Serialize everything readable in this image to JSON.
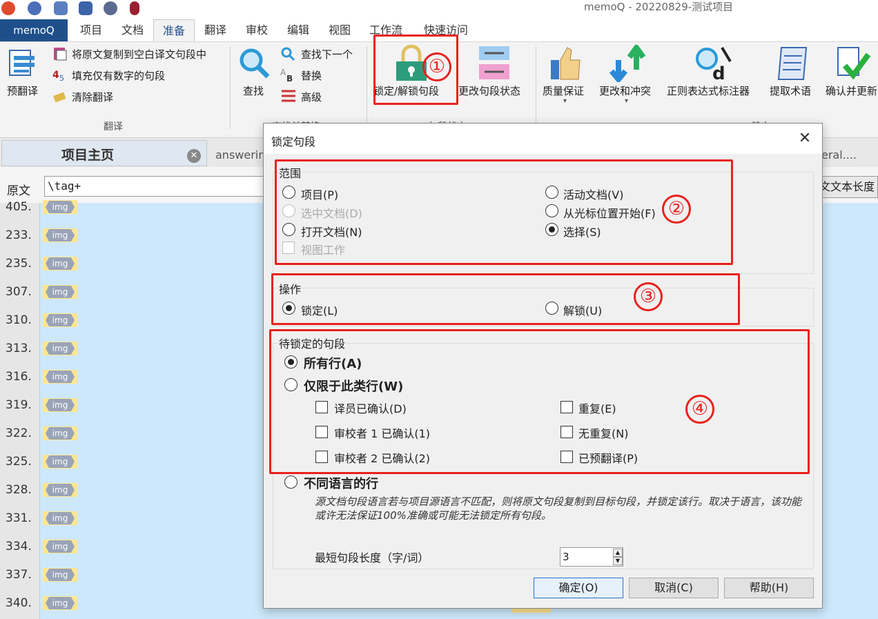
{
  "window": {
    "title": "memoQ - 20220829-测试项目"
  },
  "quick_access_icons": [
    "memoq-logo-icon",
    "help-icon",
    "settings-icon",
    "list-icon",
    "gear-icon",
    "record-icon"
  ],
  "tabs": {
    "file_label": "memoQ",
    "items": [
      "项目",
      "文档",
      "准备",
      "翻译",
      "审校",
      "编辑",
      "视图",
      "工作流",
      "快速访问"
    ],
    "active": "准备"
  },
  "ribbon": {
    "pretranslate": "预翻译",
    "copy_source": "将原文复制到空白译文句段中",
    "fill_numbers": "填充仅有数字的句段",
    "clear_translation": "清除翻译",
    "group_translate": "翻译",
    "find": "查找",
    "find_next": "查找下一个",
    "replace": "替换",
    "advanced": "高级",
    "group_find_partial": "查找并替换",
    "lock_unlock": "锁定/解锁句段",
    "change_status": "更改句段状态",
    "group_status_partial": "句段状态",
    "qa": "质量保证",
    "changes_conflicts": "更改和冲突",
    "regex_tagger": "正则表达式标注器",
    "extract_terms": "提取术语",
    "confirm_update": "确认并更新",
    "group_other_partial": "其它"
  },
  "doc_tabs": {
    "home": "项目主页",
    "tab2": "answerin",
    "tab3": "eral...."
  },
  "filter": {
    "source_label": "原文",
    "source_value": "\\tag+",
    "length_button": "文文本长度"
  },
  "grid_rows": [
    {
      "num": "405.",
      "tag": "img"
    },
    {
      "num": "233.",
      "tag": "img"
    },
    {
      "num": "235.",
      "tag": "img"
    },
    {
      "num": "307.",
      "tag": "img"
    },
    {
      "num": "310.",
      "tag": "img"
    },
    {
      "num": "313.",
      "tag": "img"
    },
    {
      "num": "316.",
      "tag": "img"
    },
    {
      "num": "319.",
      "tag": "img"
    },
    {
      "num": "322.",
      "tag": "img"
    },
    {
      "num": "325.",
      "tag": "img"
    },
    {
      "num": "328.",
      "tag": "img"
    },
    {
      "num": "331.",
      "tag": "img"
    },
    {
      "num": "334.",
      "tag": "img"
    },
    {
      "num": "337.",
      "tag": "img"
    },
    {
      "num": "340.",
      "tag": "img"
    }
  ],
  "dialog": {
    "title": "锁定句段",
    "scope": {
      "legend": "范围",
      "project": "项目(P)",
      "selected_docs": "选中文档(D)",
      "open_docs": "打开文档(N)",
      "view_work": "视图工作",
      "active_doc": "活动文档(V)",
      "from_cursor": "从光标位置开始(F)",
      "selection": "选择(S)",
      "selected": "selection"
    },
    "operation": {
      "legend": "操作",
      "lock": "锁定(L)",
      "unlock": "解锁(U)",
      "selected": "lock"
    },
    "segments": {
      "legend": "待锁定的句段",
      "all_rows": "所有行(A)",
      "only_rows": "仅限于此类行(W)",
      "translator_confirmed": "译员已确认(D)",
      "reviewer1_confirmed": "审校者 1 已确认(1)",
      "reviewer2_confirmed": "审校者 2 已确认(2)",
      "repetitions": "重复(E)",
      "no_repetitions": "无重复(N)",
      "pretranslated": "已预翻译(P)",
      "diff_language": "不同语言的行",
      "diff_language_note": "源文档句段语言若与项目源语言不匹配，则将原文句段复制到目标句段，并锁定该行。取决于语言，该功能或许无法保证100%准确或可能无法锁定所有句段。",
      "min_length_label": "最短句段长度（字/词）",
      "min_length_value": "3",
      "selected": "all_rows"
    },
    "buttons": {
      "ok": "确定(O)",
      "cancel": "取消(C)",
      "help": "帮助(H)"
    }
  },
  "annotations": {
    "c1": "①",
    "c2": "②",
    "c3": "③",
    "c4": "④",
    "color": "#e8211d"
  }
}
